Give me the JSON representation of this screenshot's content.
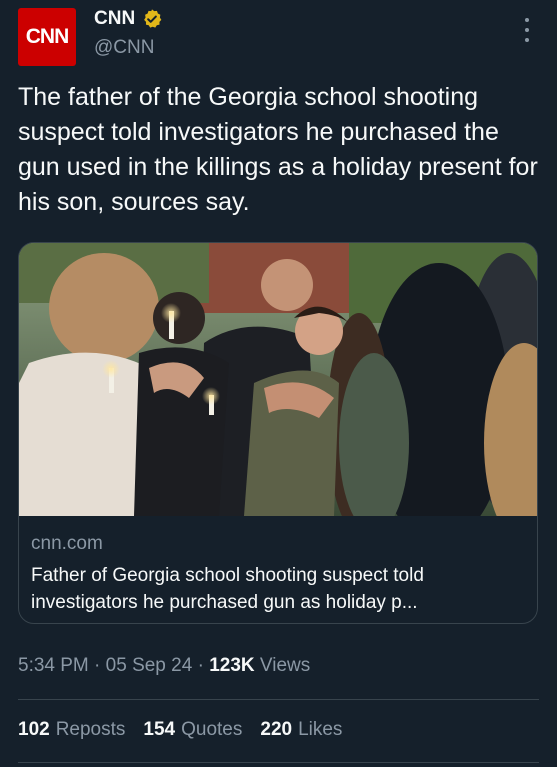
{
  "author": {
    "avatar_text": "CNN",
    "display_name": "CNN",
    "handle": "@CNN",
    "verified_color": "#e2b719"
  },
  "tweet": {
    "text": "The father of the Georgia school shooting suspect told investigators he purchased the gun used in the killings as a holiday present for his son, sources say."
  },
  "card": {
    "domain": "cnn.com",
    "title": "Father of Georgia school shooting suspect told investigators he purchased gun as holiday p..."
  },
  "meta": {
    "time": "5:34 PM",
    "date": "05 Sep 24",
    "views_count": "123K",
    "views_label": "Views"
  },
  "stats": {
    "reposts_count": "102",
    "reposts_label": "Reposts",
    "quotes_count": "154",
    "quotes_label": "Quotes",
    "likes_count": "220",
    "likes_label": "Likes"
  },
  "colors": {
    "background": "#15202b",
    "text": "#f7f9f9",
    "secondary": "#8b98a5",
    "border": "#38444d",
    "brand": "#cc0000"
  },
  "icons": [
    "verified-badge-icon",
    "more-options-icon"
  ]
}
